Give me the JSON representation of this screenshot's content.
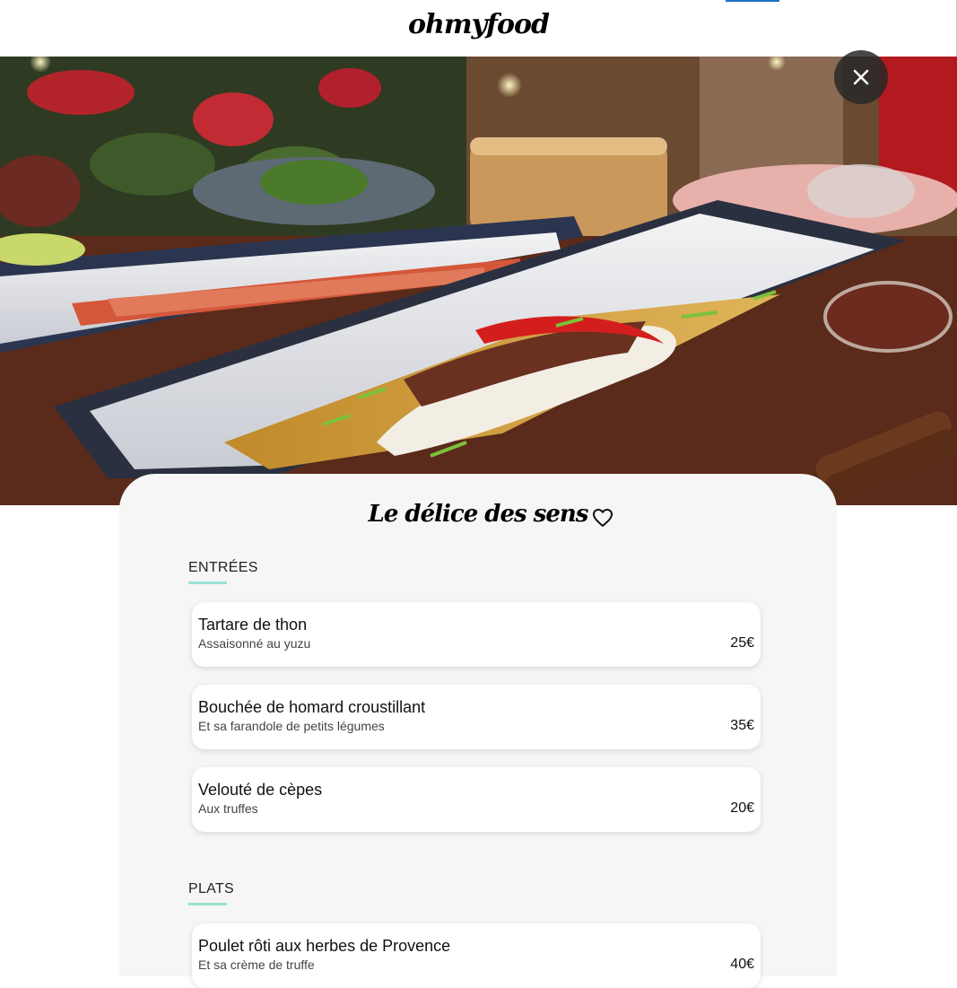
{
  "header": {
    "logo": "ohmyfood"
  },
  "hero": {
    "image": "steamed-fish-dish-photo"
  },
  "close": {
    "icon": "close-icon"
  },
  "restaurant": {
    "title": "Le délice des sens",
    "favorite_icon": "heart-outline-icon"
  },
  "menu": {
    "sections": [
      {
        "label": "ENTRÉES",
        "items": [
          {
            "name": "Tartare de thon",
            "description": "Assaisonné au yuzu",
            "price": "25€"
          },
          {
            "name": "Bouchée de homard croustillant",
            "description": "Et sa farandole de petits légumes",
            "price": "35€"
          },
          {
            "name": "Velouté de cèpes",
            "description": "Aux truffes",
            "price": "20€"
          }
        ]
      },
      {
        "label": "PLATS",
        "items": [
          {
            "name": "Poulet rôti aux herbes de Provence",
            "description": "Et sa crème de truffe",
            "price": "40€"
          }
        ]
      }
    ]
  },
  "colors": {
    "accent": "#99e2d0",
    "card_background": "#f6f6f6"
  }
}
